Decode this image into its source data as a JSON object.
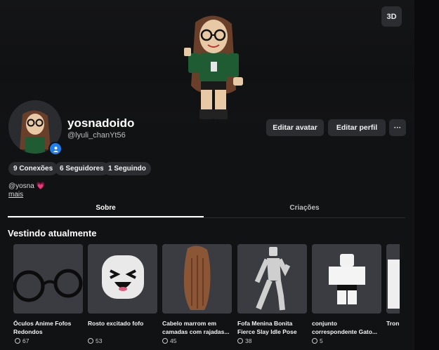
{
  "hero": {
    "view_toggle_label": "3D"
  },
  "profile": {
    "display_name": "yosnadoido",
    "username": "@lyuli_chanYt56",
    "actions": {
      "edit_avatar": "Editar avatar",
      "edit_profile": "Editar perfil",
      "more": "···"
    },
    "stats": {
      "connections": "9 Conexões",
      "followers": "6 Seguidores",
      "following": "1 Seguindo"
    },
    "bio": "@yosna 💗",
    "more_link": "mais"
  },
  "tabs": {
    "about": "Sobre",
    "creations": "Criações",
    "active": "about"
  },
  "wearing": {
    "title": "Vestindo atualmente",
    "items": [
      {
        "name": "Óculos Anime Fofos\nRedondos",
        "count": "67",
        "icon": "round-glasses-icon"
      },
      {
        "name": "Rosto excitado fofo",
        "count": "53",
        "icon": "excited-face-icon"
      },
      {
        "name": "Cabelo marrom em\ncamadas com rajadas...",
        "count": "45",
        "icon": "brown-hair-icon"
      },
      {
        "name": "Fofa Menina Bonita\nFierce Slay Idle Pose",
        "count": "38",
        "icon": "idle-pose-icon"
      },
      {
        "name": "conjunto\ncorrespondente Gato...",
        "count": "5",
        "icon": "cat-outfit-icon"
      },
      {
        "name": "Tron",
        "count": "",
        "icon": "outfit-icon"
      }
    ]
  },
  "colors": {
    "background": "#111214",
    "surface": "#2b2d31",
    "accent": "#1f7ef0",
    "card": "#3a3c41"
  }
}
